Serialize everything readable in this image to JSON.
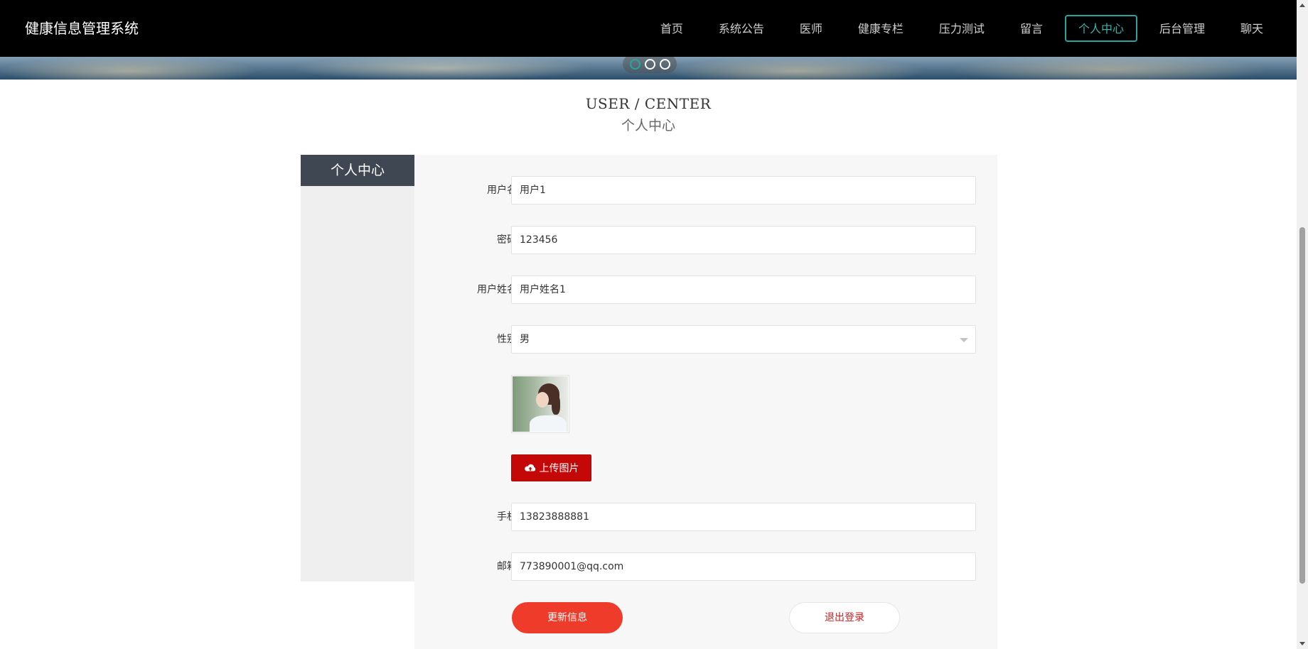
{
  "header": {
    "brand": "健康信息管理系统",
    "nav": [
      {
        "label": "首页"
      },
      {
        "label": "系统公告"
      },
      {
        "label": "医师"
      },
      {
        "label": "健康专栏"
      },
      {
        "label": "压力测试"
      },
      {
        "label": "留言"
      },
      {
        "label": "个人中心",
        "active": true
      },
      {
        "label": "后台管理"
      },
      {
        "label": "聊天"
      }
    ],
    "accent_color": "#2aa59e"
  },
  "carousel": {
    "dots": 3,
    "active_index": 0
  },
  "section": {
    "title_en": "USER / CENTER",
    "title_cn": "个人中心"
  },
  "sidebar": {
    "title": "个人中心"
  },
  "form": {
    "username": {
      "label": "用户名",
      "value": "用户1"
    },
    "password": {
      "label": "密码",
      "value": "123456"
    },
    "realname": {
      "label": "用户姓名",
      "value": "用户姓名1"
    },
    "gender": {
      "label": "性别",
      "value": "男"
    },
    "upload": {
      "label": "上传图片",
      "icon": "cloud-upload-icon"
    },
    "phone": {
      "label": "手机",
      "value": "13823888881"
    },
    "email": {
      "label": "邮箱",
      "value": "773890001@qq.com"
    },
    "update_button": "更新信息",
    "logout_button": "退出登录"
  }
}
